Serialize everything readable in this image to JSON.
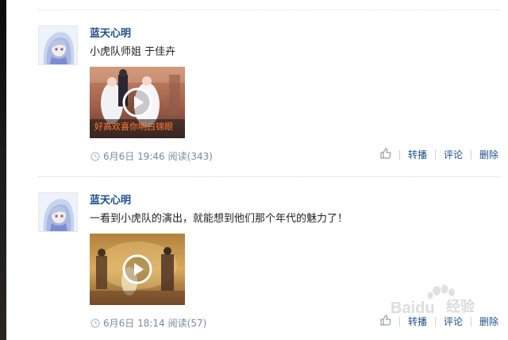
{
  "posts": [
    {
      "username": "蓝天心明",
      "content": "小虎队师姐 于佳卉",
      "video_caption": "好高欢喜你明白锦眼",
      "date": "6月6日 19:46",
      "views_label": "阅读(343)",
      "actions": [
        "转播",
        "评论",
        "删除"
      ],
      "icons": {
        "avatar": "anime-girl-avatar",
        "play": "play-icon",
        "like": "thumbs-up-icon",
        "meta": "clock-icon"
      }
    },
    {
      "username": "蓝天心明",
      "content": "一看到小虎队的演出，就能想到他们那个年代的魅力了！",
      "date": "6月6日 18:14",
      "views_label": "阅读(57)",
      "actions": [
        "转播",
        "评论",
        "删除"
      ],
      "icons": {
        "avatar": "anime-girl-avatar",
        "play": "play-icon",
        "like": "thumbs-up-icon",
        "meta": "clock-icon"
      }
    }
  ],
  "watermark": {
    "brand": "Baidu",
    "label": "经验",
    "icon": "paw-logo"
  },
  "colors": {
    "link": "#1f4e8c",
    "meta": "#7a8b9e"
  }
}
